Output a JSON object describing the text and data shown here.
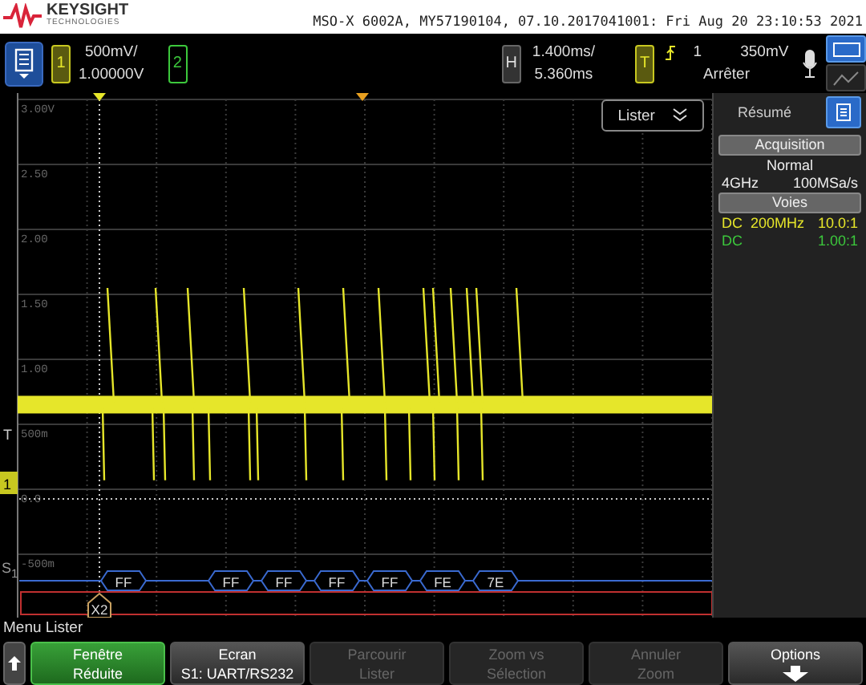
{
  "header": {
    "brand": "KEYSIGHT",
    "brand_sub": "TECHNOLOGIES",
    "title": "MSO-X 6002A, MY57190104, 07.10.2017041001: Fri Aug 20 23:10:53 2021"
  },
  "toolbar": {
    "channel_1": {
      "label": "1",
      "scale": "500mV/",
      "offset": "1.00000V"
    },
    "channel_2": {
      "label": "2"
    },
    "horizontal": {
      "label": "H",
      "scale": "1.400ms/",
      "delay": "5.360ms"
    },
    "trigger": {
      "label": "T",
      "source": "1",
      "level": "350mV",
      "status": "Arrêter"
    }
  },
  "display": {
    "y_labels": [
      "3.00V",
      "2.50",
      "2.00",
      "1.50",
      "1.00",
      "500m",
      "0.0",
      "-500m"
    ],
    "lister_button": "Lister",
    "trigger_marker": "T",
    "channel_marker": "1",
    "bus_label": "S$_{1}$",
    "cursor_label": "X2",
    "packets": [
      "FF",
      "FF",
      "FF",
      "FF",
      "FF",
      "FE",
      "7E"
    ]
  },
  "panel": {
    "title": "Résumé",
    "acquisition": "Acquisition",
    "mode": "Normal",
    "bandwidth": "4GHz",
    "sample_rate": "100MSa/s",
    "channels_button": "Voies",
    "channels": [
      {
        "coupling": "DC",
        "bandwidth": "200MHz",
        "probe": "10.0:1",
        "color": "#e6e62a"
      },
      {
        "coupling": "DC",
        "probe": "1.00:1",
        "color": "#3cc83c"
      }
    ]
  },
  "menu": {
    "title": "Menu Lister",
    "softkeys": [
      {
        "lines": [
          "Fenêtre",
          "Réduite"
        ],
        "on": true,
        "disabled": false
      },
      {
        "lines": [
          "Ecran",
          "S1: UART/RS232"
        ],
        "on": false,
        "disabled": false
      },
      {
        "lines": [
          "Parcourir",
          "Lister"
        ],
        "on": false,
        "disabled": true
      },
      {
        "lines": [
          "Zoom vs",
          "Sélection"
        ],
        "on": false,
        "disabled": true
      },
      {
        "lines": [
          "Annuler",
          "Zoom"
        ],
        "on": false,
        "disabled": true
      },
      {
        "lines": [
          "Options"
        ],
        "on": false,
        "disabled": false
      }
    ]
  }
}
